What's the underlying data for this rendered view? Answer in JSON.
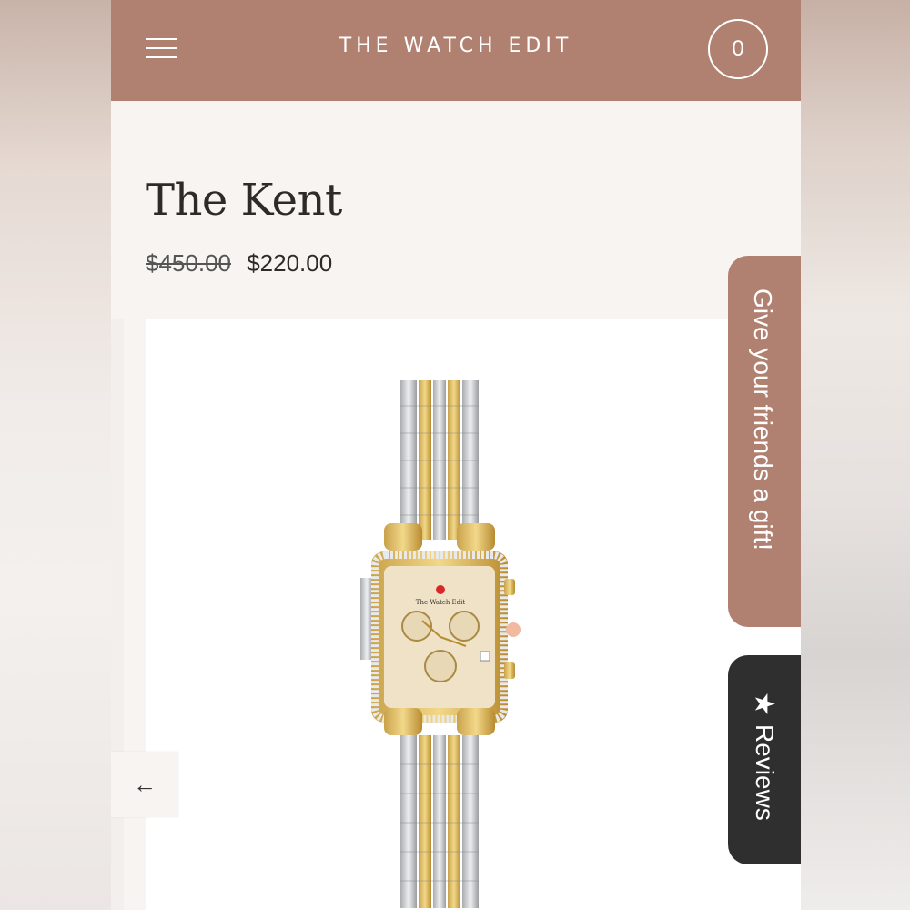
{
  "header": {
    "brand": "THE WATCH EDIT",
    "cart_count": "0",
    "menu_icon": "hamburger-icon"
  },
  "product": {
    "title": "The Kent",
    "price_original": "$450.00",
    "price_sale": "$220.00",
    "image_dial_text": "The Watch Edit"
  },
  "gallery": {
    "prev_icon": "arrow-left-icon",
    "prev_glyph": "←"
  },
  "floating_tabs": {
    "gift_label": "Give your friends a gift!",
    "reviews_label": "Reviews",
    "reviews_icon": "star-icon"
  },
  "colors": {
    "accent": "#b08070",
    "reviews_tab": "#2f2f2f",
    "page_background": "#f7f4f1"
  }
}
